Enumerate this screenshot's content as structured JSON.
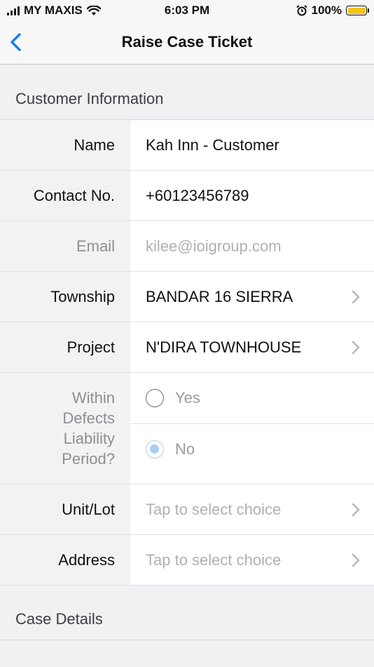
{
  "status": {
    "carrier": "MY MAXIS",
    "time": "6:03 PM",
    "battery": "100%"
  },
  "nav": {
    "title": "Raise Case Ticket"
  },
  "sections": {
    "customer_info": "Customer Information",
    "case_details": "Case Details"
  },
  "fields": {
    "name": {
      "label": "Name",
      "value": "Kah Inn - Customer"
    },
    "contact": {
      "label": "Contact No.",
      "value": "+60123456789"
    },
    "email": {
      "label": "Email",
      "value": "kilee@ioigroup.com"
    },
    "township": {
      "label": "Township",
      "value": "BANDAR 16 SIERRA"
    },
    "project": {
      "label": "Project",
      "value": "N'DIRA TOWNHOUSE"
    },
    "defects": {
      "label_lines": [
        "Within",
        "Defects",
        "Liability",
        "Period?"
      ],
      "options": [
        "Yes",
        "No"
      ],
      "selected": "No"
    },
    "unit": {
      "label": "Unit/Lot",
      "placeholder": "Tap to select choice"
    },
    "address": {
      "label": "Address",
      "placeholder": "Tap to select choice"
    }
  }
}
